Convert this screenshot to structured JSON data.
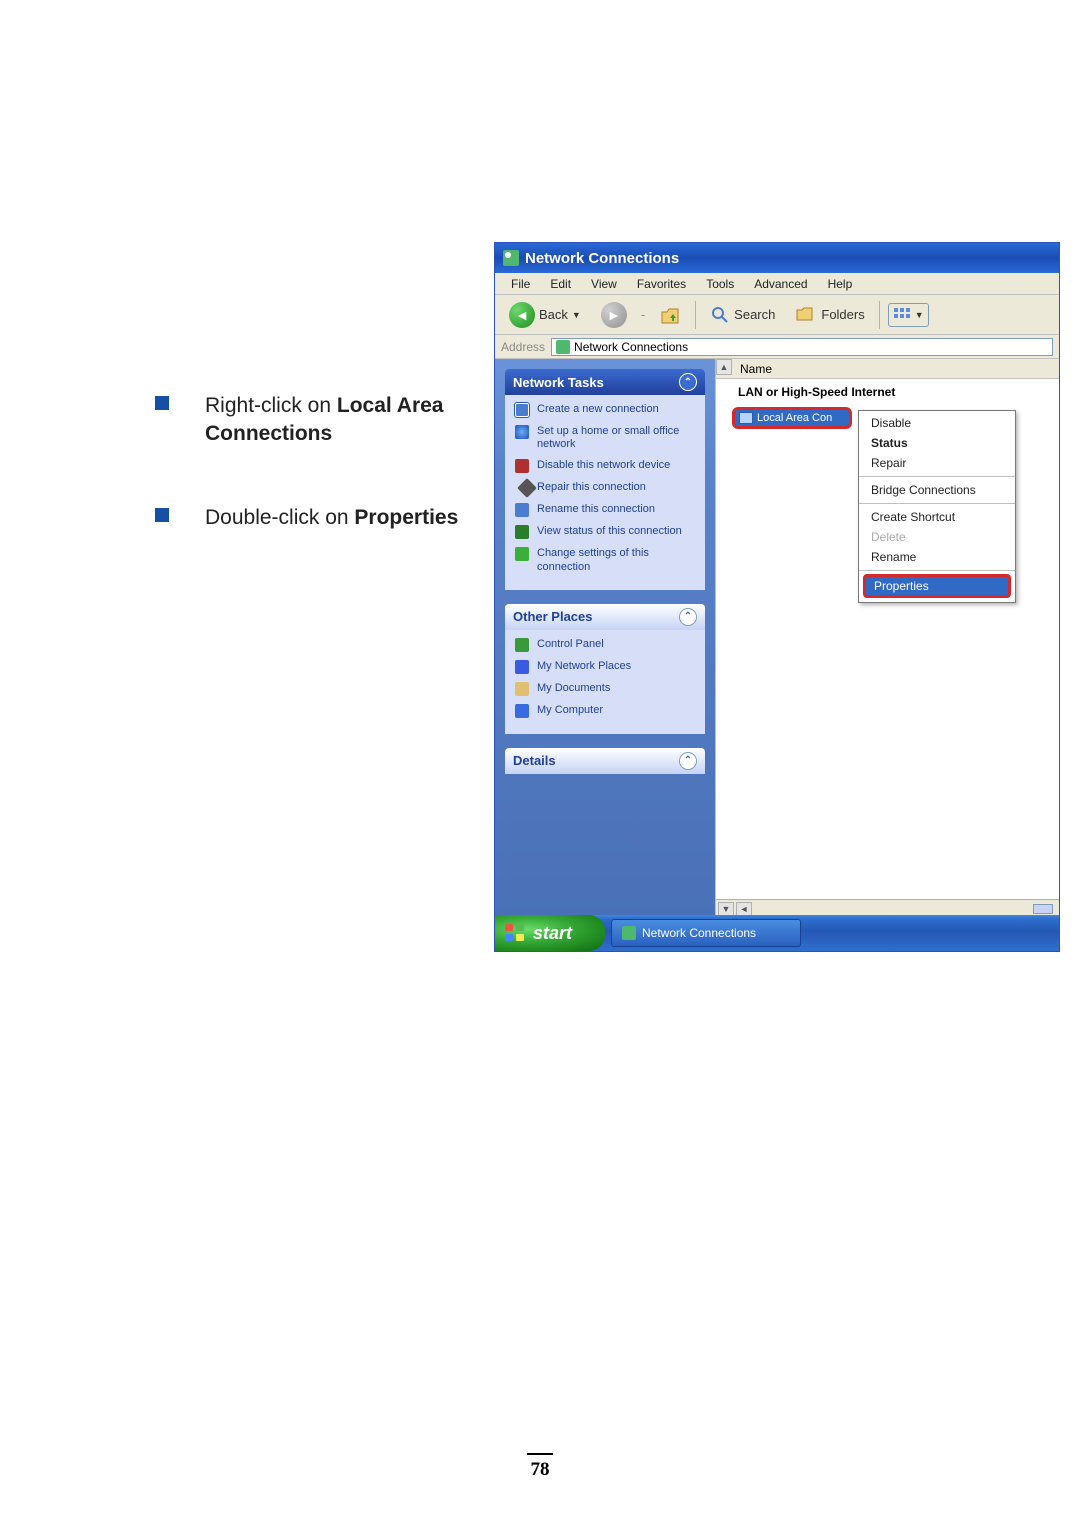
{
  "page_number": "78",
  "instructions": [
    {
      "prefix": "Right-click on ",
      "bold": "Local Area Connections"
    },
    {
      "prefix": "Double-click on ",
      "bold": "Properties"
    }
  ],
  "window": {
    "title": "Network Connections",
    "menubar": [
      "File",
      "Edit",
      "View",
      "Favorites",
      "Tools",
      "Advanced",
      "Help"
    ],
    "toolbar": {
      "back": "Back",
      "search": "Search",
      "folders": "Folders"
    },
    "address": {
      "label": "Address",
      "value": "Network Connections"
    },
    "tasks": {
      "network_tasks": {
        "title": "Network Tasks",
        "items": [
          "Create a new connection",
          "Set up a home or small office network",
          "Disable this network device",
          "Repair this connection",
          "Rename this connection",
          "View status of this connection",
          "Change settings of this connection"
        ]
      },
      "other_places": {
        "title": "Other Places",
        "items": [
          "Control Panel",
          "My Network Places",
          "My Documents",
          "My Computer"
        ]
      },
      "details": {
        "title": "Details"
      }
    },
    "content": {
      "column": "Name",
      "category": "LAN or High-Speed Internet",
      "item_label": "Local Area Con"
    },
    "context_menu": {
      "items": [
        {
          "label": "Disable",
          "bold": false,
          "disabled": false
        },
        {
          "label": "Status",
          "bold": true,
          "disabled": false
        },
        {
          "label": "Repair",
          "bold": false,
          "disabled": false
        }
      ],
      "group2": [
        {
          "label": "Bridge Connections",
          "bold": false,
          "disabled": false
        }
      ],
      "group3": [
        {
          "label": "Create Shortcut",
          "bold": false,
          "disabled": false
        },
        {
          "label": "Delete",
          "bold": false,
          "disabled": true
        },
        {
          "label": "Rename",
          "bold": false,
          "disabled": false
        }
      ],
      "properties": "Properties"
    }
  },
  "taskbar": {
    "start": "start",
    "app": "Network Connections"
  }
}
